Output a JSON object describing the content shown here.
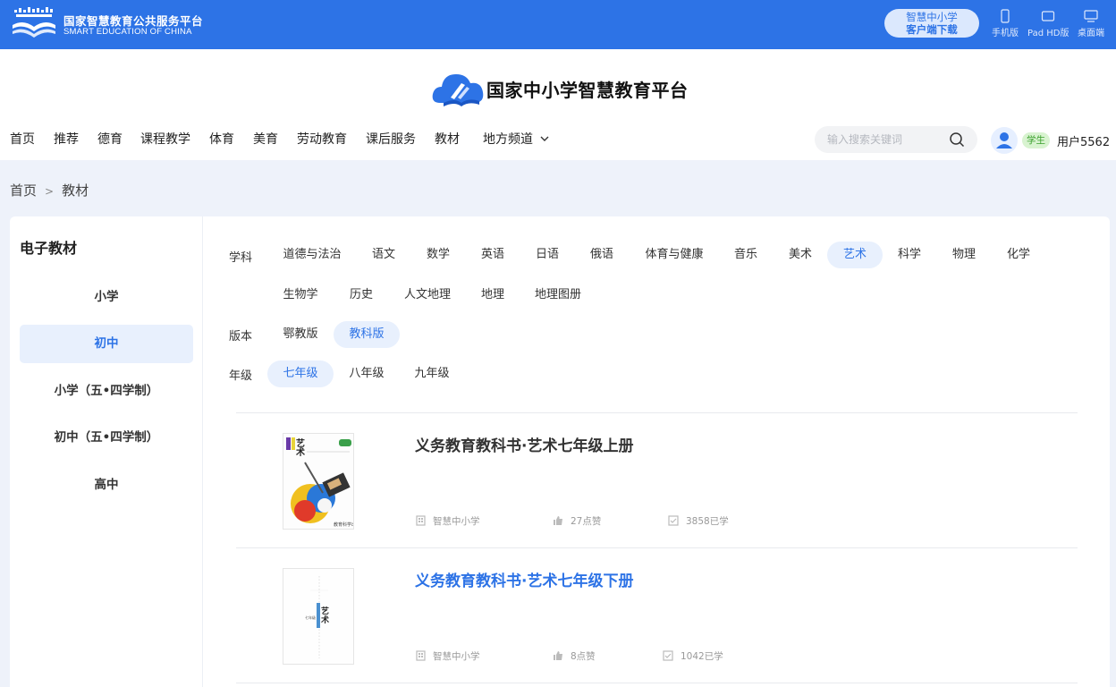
{
  "topbar": {
    "brand_cn": "国家智慧教育公共服务平台",
    "brand_en": "SMART EDUCATION OF CHINA",
    "download_line1": "智慧中小学",
    "download_line2": "客户端下载",
    "devices": [
      {
        "label": "手机版",
        "icon": "phone-icon"
      },
      {
        "label": "Pad HD版",
        "icon": "tablet-icon"
      },
      {
        "label": "桌面端",
        "icon": "desktop-icon"
      }
    ],
    "accent": "#2d73e6"
  },
  "header": {
    "site_title": "国家中小学智慧教育平台",
    "nav": [
      "首页",
      "推荐",
      "德育",
      "课程教学",
      "体育",
      "美育",
      "劳动教育",
      "课后服务",
      "教材",
      "地方频道"
    ],
    "search_placeholder": "输入搜索关键词",
    "user_badge": "学生",
    "user_name": "用户5562"
  },
  "breadcrumb": [
    "首页",
    "教材"
  ],
  "sidebar": {
    "title": "电子教材",
    "items": [
      "小学",
      "初中",
      "小学（五•四学制）",
      "初中（五•四学制）",
      "高中"
    ],
    "active_index": 1
  },
  "filters": {
    "subject_label": "学科",
    "subjects_row1": [
      "道德与法治",
      "语文",
      "数学",
      "英语",
      "日语",
      "俄语",
      "体育与健康",
      "音乐",
      "美术",
      "艺术",
      "科学",
      "物理",
      "化学"
    ],
    "subjects_row2": [
      "生物学",
      "历史",
      "人文地理",
      "地理",
      "地理图册"
    ],
    "active_subject": "艺术",
    "edition_label": "版本",
    "editions": [
      "鄂教版",
      "教科版"
    ],
    "active_edition": "教科版",
    "grade_label": "年级",
    "grades": [
      "七年级",
      "八年级",
      "九年级"
    ],
    "active_grade": "七年级"
  },
  "books": [
    {
      "title": "义务教育教科书·艺术七年级上册",
      "source": "智慧中小学",
      "likes": "27点赞",
      "learners": "3858已学",
      "highlighted": false
    },
    {
      "title": "义务教育教科书·艺术七年级下册",
      "source": "智慧中小学",
      "likes": "8点赞",
      "learners": "1042已学",
      "highlighted": true
    }
  ]
}
